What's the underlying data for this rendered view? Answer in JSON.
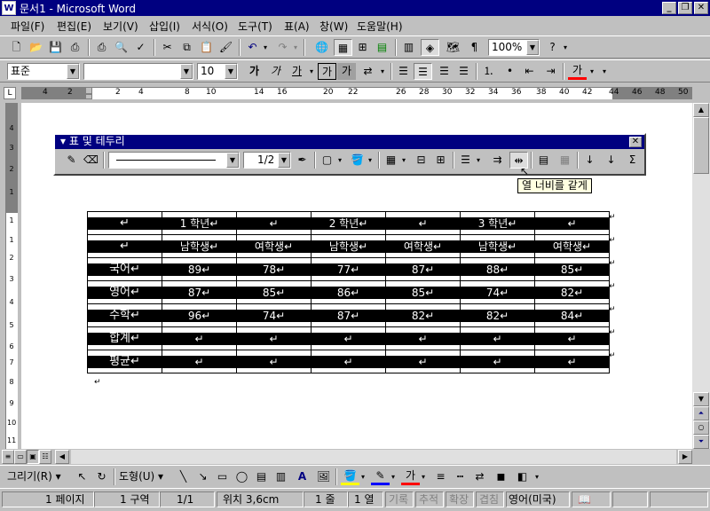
{
  "window": {
    "title": "문서1 - Microsoft Word",
    "app_icon": "word-doc-icon"
  },
  "menu": [
    "파일(F)",
    "편집(E)",
    "보기(V)",
    "삽입(I)",
    "서식(O)",
    "도구(T)",
    "표(A)",
    "창(W)",
    "도움말(H)"
  ],
  "standard_toolbar": {
    "zoom": "100%"
  },
  "format_toolbar": {
    "style": "표준",
    "font": "",
    "size": "10",
    "bold_label": "가",
    "italic_label": "가",
    "underline_label": "가",
    "font_color_label": "가"
  },
  "ruler": {
    "numbers": [
      "4",
      "2",
      "2",
      "4",
      "8",
      "10",
      "14",
      "16",
      "20",
      "22",
      "26",
      "28",
      "30",
      "32",
      "34",
      "36",
      "38",
      "40",
      "42",
      "44",
      "46",
      "48",
      "50"
    ]
  },
  "vruler": {
    "numbers": [
      "4",
      "3",
      "2",
      "1",
      "1",
      "1",
      "2",
      "3",
      "4",
      "5",
      "6",
      "7",
      "8",
      "9",
      "10",
      "11"
    ]
  },
  "floating_toolbar": {
    "title": "표 및 테두리",
    "line_weight": "1/2",
    "tooltip": "열 너비를 같게"
  },
  "table": {
    "rows": [
      [
        "↵",
        "1 학년↵",
        "↵",
        "2 학년↵",
        "↵",
        "3 학년↵",
        "↵"
      ],
      [
        "↵",
        "남학생↵",
        "여학생↵",
        "남학생↵",
        "여학생↵",
        "남학생↵",
        "여학생↵"
      ],
      [
        "국어↵",
        "89↵",
        "78↵",
        "77↵",
        "87↵",
        "88↵",
        "85↵"
      ],
      [
        "영어↵",
        "87↵",
        "85↵",
        "86↵",
        "85↵",
        "74↵",
        "82↵"
      ],
      [
        "수학↵",
        "96↵",
        "74↵",
        "87↵",
        "82↵",
        "82↵",
        "84↵"
      ],
      [
        "합계↵",
        "↵",
        "↵",
        "↵",
        "↵",
        "↵",
        "↵"
      ],
      [
        "평균↵",
        "↵",
        "↵",
        "↵",
        "↵",
        "↵",
        "↵"
      ]
    ],
    "row_end_mark": "↵",
    "para_mark": "↵"
  },
  "draw_toolbar": {
    "draw_label": "그리기(R)",
    "autoshape_label": "도형(U)"
  },
  "status": {
    "page": "1 페이지",
    "section": "1 구역",
    "pages": "1/1",
    "position": "위치 3,6cm",
    "line": "1 줄",
    "col": "1 열",
    "rec": "기록",
    "trk": "추적",
    "ext": "확장",
    "ovr": "겹침",
    "language": "영어(미국)"
  }
}
